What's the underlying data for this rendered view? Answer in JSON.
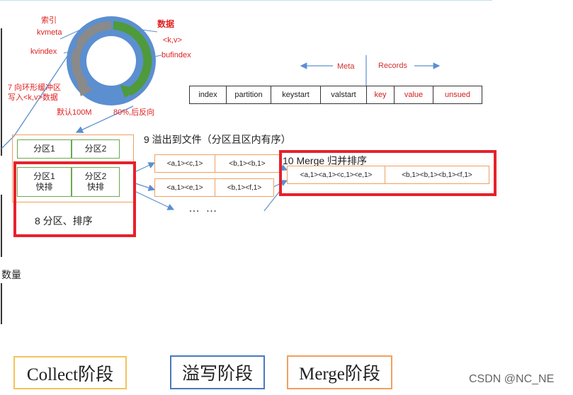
{
  "ring": {
    "index_label": "索引",
    "kvmeta": "kvmeta",
    "kvindex": "kvindex",
    "data_label": "数据",
    "kv": "<k,v>",
    "bufindex": "bufindex",
    "default_size": "默认100M",
    "reverse": "80%,后反向",
    "write_line1": "7 向环形缓冲区",
    "write_line2": "写入<k,v>数据"
  },
  "meta_header": {
    "meta": "Meta",
    "records": "Records"
  },
  "meta_cells": [
    "index",
    "partition",
    "keystart",
    "valstart",
    "key",
    "value",
    "unsued"
  ],
  "partitions": {
    "p1": "分区1",
    "p2": "分区2",
    "p1_sorted": [
      "分区1",
      "快排"
    ],
    "p2_sorted": [
      "分区2",
      "快排"
    ]
  },
  "step8": "8 分区、排序",
  "step9": "9 溢出到文件（分区且区内有序）",
  "spill_files": [
    [
      "<a,1><c,1>",
      "<b,1><b,1>"
    ],
    [
      "<a,1><e,1>",
      "<b,1><f,1>"
    ]
  ],
  "ellipsis": "… …",
  "step10": "10 Merge 归并排序",
  "merged": [
    "<a,1><a,1><c,1><e,1>",
    "<b,1><b,1><b,1><f,1>"
  ],
  "left_side_text": "数量",
  "legend": {
    "collect": "Collect阶段",
    "spill": "溢写阶段",
    "merge": "Merge阶段"
  },
  "watermark": "CSDN @NC_NE",
  "colors": {
    "ring_outer": "#5b8fd0",
    "arrow_gray": "#8a8a8a",
    "arrow_green": "#4f9a3a",
    "red": "#e8202a",
    "orange": "#f0a060",
    "legend_yellow": "#f2c45a",
    "legend_blue": "#4a78c0"
  }
}
